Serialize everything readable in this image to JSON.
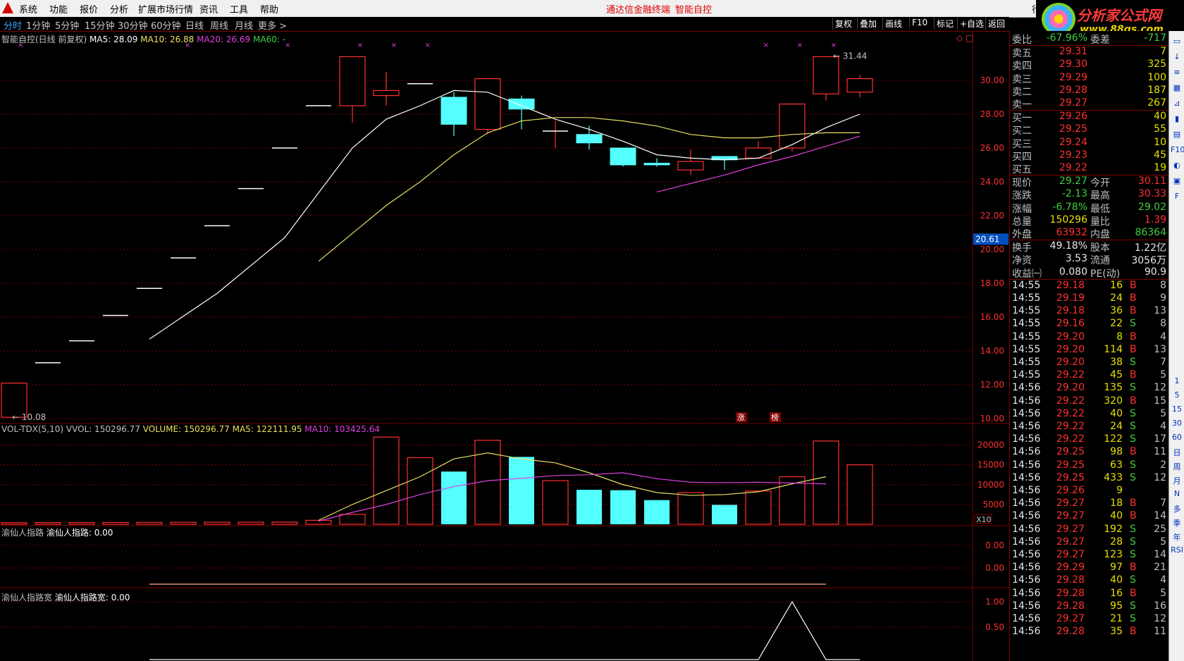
{
  "menu": {
    "items": [
      "系统",
      "功能",
      "报价",
      "分析",
      "扩展市场行情",
      "资讯",
      "工具",
      "帮助"
    ],
    "promo1": "通达信金融终端",
    "promo2": "智能自控",
    "right_item": "行"
  },
  "logo": {
    "line1": "分析家公式网",
    "line2": "www.88gs.com"
  },
  "toolbar": {
    "periods": [
      "分时",
      "1分钟",
      "5分钟",
      "15分钟",
      "30分钟",
      "60分钟",
      "日线",
      "周线",
      "月线",
      "更多 >"
    ],
    "active": "分时",
    "right_buttons": [
      "复权",
      "叠加",
      "画线",
      "F10",
      "标记",
      "+自选",
      "返回"
    ]
  },
  "main_header": {
    "title": "智能自控(日线 前复权)",
    "ma5": "MA5: 28.09",
    "ma10": "MA10: 26.88",
    "ma20": "MA20: 26.69",
    "ma60": "MA60: -"
  },
  "annotations": {
    "high_label": "31.44",
    "low_label": "10.08",
    "badge_zhang": "涨",
    "badge_bang": "榜",
    "price_tag": "20.61",
    "vol_x10": "X10"
  },
  "price_axis": [
    "30.00",
    "28.00",
    "26.00",
    "24.00",
    "22.00",
    "20.00",
    "18.00",
    "16.00",
    "14.00",
    "12.00",
    "10.00"
  ],
  "vol_header": {
    "name": "VOL-TDX(5,10)",
    "vvol": "VVOL: 150296.77",
    "volume": "VOLUME: 150296.77",
    "ma5": "MA5: 122111.95",
    "ma10": "MA10: 103425.64"
  },
  "vol_axis": [
    "20000",
    "15000",
    "10000",
    "5000"
  ],
  "ind1": {
    "name": "渝仙人指路",
    "value": "渝仙人指路: 0.00",
    "axis": [
      "0.00",
      "0.00"
    ]
  },
  "ind2": {
    "name": "渝仙人指路宽",
    "value": "渝仙人指路宽: 0.00",
    "axis": [
      "1.00",
      "0.50"
    ]
  },
  "colors": {
    "up": "#ff3030",
    "down": "#54ffff",
    "ma5": "#ffffff",
    "ma10": "#e8e060",
    "ma20": "#e040e0",
    "grid": "#800000"
  },
  "chart_data": {
    "type": "candlestick",
    "title": "智能自控(日线 前复权)",
    "ylim": [
      10.0,
      31.9
    ],
    "candles": [
      {
        "o": 10.08,
        "h": 12.1,
        "l": 10.08,
        "c": 12.1
      },
      {
        "o": 13.3,
        "h": 13.3,
        "l": 13.3,
        "c": 13.3
      },
      {
        "o": 14.6,
        "h": 14.6,
        "l": 14.6,
        "c": 14.6
      },
      {
        "o": 16.1,
        "h": 16.1,
        "l": 16.1,
        "c": 16.1
      },
      {
        "o": 17.7,
        "h": 17.7,
        "l": 17.7,
        "c": 17.7
      },
      {
        "o": 19.5,
        "h": 19.5,
        "l": 19.5,
        "c": 19.5
      },
      {
        "o": 21.4,
        "h": 21.4,
        "l": 21.4,
        "c": 21.4
      },
      {
        "o": 23.6,
        "h": 23.6,
        "l": 23.6,
        "c": 23.6
      },
      {
        "o": 26.0,
        "h": 26.0,
        "l": 26.0,
        "c": 26.0
      },
      {
        "o": 28.5,
        "h": 28.5,
        "l": 28.5,
        "c": 28.5
      },
      {
        "o": 28.5,
        "h": 31.4,
        "l": 27.5,
        "c": 31.4
      },
      {
        "o": 29.1,
        "h": 30.5,
        "l": 28.5,
        "c": 29.4
      },
      {
        "o": 29.8,
        "h": 29.8,
        "l": 29.8,
        "c": 29.8
      },
      {
        "o": 29.0,
        "h": 29.3,
        "l": 26.7,
        "c": 27.4
      },
      {
        "o": 27.1,
        "h": 30.1,
        "l": 26.8,
        "c": 30.1
      },
      {
        "o": 28.9,
        "h": 29.1,
        "l": 27.1,
        "c": 28.3
      },
      {
        "o": 27.0,
        "h": 27.6,
        "l": 26.0,
        "c": 27.0
      },
      {
        "o": 26.8,
        "h": 27.3,
        "l": 25.9,
        "c": 26.3
      },
      {
        "o": 26.0,
        "h": 26.0,
        "l": 24.9,
        "c": 25.0
      },
      {
        "o": 25.1,
        "h": 25.4,
        "l": 24.9,
        "c": 25.0
      },
      {
        "o": 24.7,
        "h": 25.9,
        "l": 24.4,
        "c": 25.2
      },
      {
        "o": 25.5,
        "h": 25.5,
        "l": 24.7,
        "c": 25.3
      },
      {
        "o": 25.4,
        "h": 26.4,
        "l": 25.4,
        "c": 26.0
      },
      {
        "o": 26.0,
        "h": 28.6,
        "l": 25.8,
        "c": 28.6
      },
      {
        "o": 29.2,
        "h": 31.44,
        "l": 28.8,
        "c": 31.4
      },
      {
        "o": 29.3,
        "h": 30.3,
        "l": 29.0,
        "c": 30.1
      }
    ],
    "ma5": [
      [
        4,
        14.7
      ],
      [
        6,
        17.4
      ],
      [
        8,
        20.7
      ],
      [
        10,
        26.0
      ],
      [
        11,
        27.7
      ],
      [
        12,
        28.5
      ],
      [
        13,
        29.4
      ],
      [
        14,
        29.3
      ],
      [
        15,
        28.5
      ],
      [
        16,
        27.7
      ],
      [
        17,
        27.1
      ],
      [
        18,
        26.4
      ],
      [
        19,
        25.6
      ],
      [
        20,
        25.4
      ],
      [
        21,
        25.3
      ],
      [
        22,
        25.4
      ],
      [
        23,
        26.2
      ],
      [
        24,
        27.2
      ],
      [
        25,
        28.0
      ]
    ],
    "ma10": [
      [
        9,
        19.3
      ],
      [
        11,
        22.6
      ],
      [
        12,
        24.0
      ],
      [
        13,
        25.6
      ],
      [
        14,
        26.9
      ],
      [
        15,
        27.6
      ],
      [
        16,
        27.8
      ],
      [
        17,
        27.8
      ],
      [
        18,
        27.6
      ],
      [
        19,
        27.3
      ],
      [
        20,
        26.8
      ],
      [
        21,
        26.6
      ],
      [
        22,
        26.6
      ],
      [
        23,
        26.8
      ],
      [
        24,
        26.9
      ],
      [
        25,
        26.9
      ]
    ],
    "ma20": [
      [
        19,
        23.4
      ],
      [
        21,
        24.4
      ],
      [
        22,
        25.0
      ],
      [
        23,
        25.5
      ],
      [
        24,
        26.1
      ],
      [
        25,
        26.7
      ]
    ],
    "volume": [
      400,
      420,
      440,
      460,
      480,
      500,
      520,
      540,
      560,
      1000,
      2500,
      22000,
      16800,
      13300,
      21200,
      17000,
      11000,
      8700,
      8600,
      6100,
      8000,
      4900,
      8400,
      12000,
      21000,
      15000
    ],
    "vol_ma5": [
      [
        9,
        1000
      ],
      [
        10,
        5000
      ],
      [
        11,
        8500
      ],
      [
        12,
        12000
      ],
      [
        13,
        16500
      ],
      [
        14,
        18000
      ],
      [
        15,
        16500
      ],
      [
        16,
        15500
      ],
      [
        17,
        13000
      ],
      [
        18,
        10000
      ],
      [
        19,
        8000
      ],
      [
        20,
        7300
      ],
      [
        21,
        7500
      ],
      [
        22,
        8200
      ],
      [
        23,
        10200
      ],
      [
        24,
        12000
      ]
    ],
    "vol_ma10": [
      [
        9,
        800
      ],
      [
        10,
        3000
      ],
      [
        11,
        5000
      ],
      [
        12,
        7500
      ],
      [
        13,
        9500
      ],
      [
        14,
        11000
      ],
      [
        15,
        11600
      ],
      [
        16,
        12300
      ],
      [
        17,
        12500
      ],
      [
        18,
        13000
      ],
      [
        19,
        11500
      ],
      [
        20,
        10600
      ],
      [
        21,
        10500
      ],
      [
        22,
        10600
      ],
      [
        23,
        10400
      ],
      [
        24,
        10200
      ]
    ]
  },
  "quote": {
    "weibi_label": "委比",
    "weibi_val": "-67.96%",
    "weicha_label": "委差",
    "weicha_val": "-717",
    "sells": [
      [
        "卖五",
        "29.31",
        "7"
      ],
      [
        "卖四",
        "29.30",
        "325"
      ],
      [
        "卖三",
        "29.29",
        "100"
      ],
      [
        "卖二",
        "29.28",
        "187"
      ],
      [
        "卖一",
        "29.27",
        "267"
      ]
    ],
    "buys": [
      [
        "买一",
        "29.26",
        "40"
      ],
      [
        "买二",
        "29.25",
        "55"
      ],
      [
        "买三",
        "29.24",
        "10"
      ],
      [
        "买四",
        "29.23",
        "45"
      ],
      [
        "买五",
        "29.22",
        "19"
      ]
    ],
    "stats1": [
      [
        "现价",
        "29.27",
        "今开",
        "30.11"
      ],
      [
        "涨跌",
        "-2.13",
        "最高",
        "30.33"
      ],
      [
        "涨幅",
        "-6.78%",
        "最低",
        "29.02"
      ],
      [
        "总量",
        "150296",
        "量比",
        "1.39"
      ],
      [
        "外盘",
        "63932",
        "内盘",
        "86364"
      ]
    ],
    "stats2": [
      [
        "换手",
        "49.18%",
        "股本",
        "1.22亿"
      ],
      [
        "净资",
        "3.53",
        "流通",
        "3056万"
      ],
      [
        "收益㈠",
        "0.080",
        "PE(动)",
        "90.9"
      ]
    ]
  },
  "ticks": [
    [
      "14:55",
      "29.18",
      "16",
      "B",
      "8"
    ],
    [
      "14:55",
      "29.19",
      "24",
      "B",
      "9"
    ],
    [
      "14:55",
      "29.18",
      "36",
      "B",
      "13"
    ],
    [
      "14:55",
      "29.16",
      "22",
      "S",
      "8"
    ],
    [
      "14:55",
      "29.20",
      "8",
      "B",
      "4"
    ],
    [
      "14:55",
      "29.20",
      "114",
      "B",
      "13"
    ],
    [
      "14:55",
      "29.20",
      "38",
      "S",
      "7"
    ],
    [
      "14:55",
      "29.22",
      "45",
      "B",
      "5"
    ],
    [
      "14:56",
      "29.20",
      "135",
      "S",
      "12"
    ],
    [
      "14:56",
      "29.22",
      "320",
      "B",
      "15"
    ],
    [
      "14:56",
      "29.22",
      "40",
      "S",
      "5"
    ],
    [
      "14:56",
      "29.22",
      "24",
      "S",
      "4"
    ],
    [
      "14:56",
      "29.22",
      "122",
      "S",
      "17"
    ],
    [
      "14:56",
      "29.25",
      "98",
      "B",
      "11"
    ],
    [
      "14:56",
      "29.25",
      "63",
      "S",
      "2"
    ],
    [
      "14:56",
      "29.25",
      "433",
      "S",
      "12"
    ],
    [
      "14:56",
      "29.26",
      "9",
      "",
      ""
    ],
    [
      "14:56",
      "29.27",
      "18",
      "B",
      "7"
    ],
    [
      "14:56",
      "29.27",
      "40",
      "B",
      "14"
    ],
    [
      "14:56",
      "29.27",
      "192",
      "S",
      "25"
    ],
    [
      "14:56",
      "29.27",
      "28",
      "S",
      "5"
    ],
    [
      "14:56",
      "29.27",
      "123",
      "S",
      "14"
    ],
    [
      "14:56",
      "29.29",
      "97",
      "B",
      "21"
    ],
    [
      "14:56",
      "29.28",
      "40",
      "S",
      "4"
    ],
    [
      "14:56",
      "29.28",
      "16",
      "B",
      "5"
    ],
    [
      "14:56",
      "29.28",
      "95",
      "S",
      "16"
    ],
    [
      "14:56",
      "29.27",
      "21",
      "S",
      "12"
    ],
    [
      "14:56",
      "29.28",
      "35",
      "B",
      "11"
    ]
  ],
  "sidebar": [
    "1",
    "5",
    "15",
    "30",
    "60",
    "日",
    "周",
    "月",
    "N",
    "多",
    "季",
    "年",
    "RSI"
  ]
}
